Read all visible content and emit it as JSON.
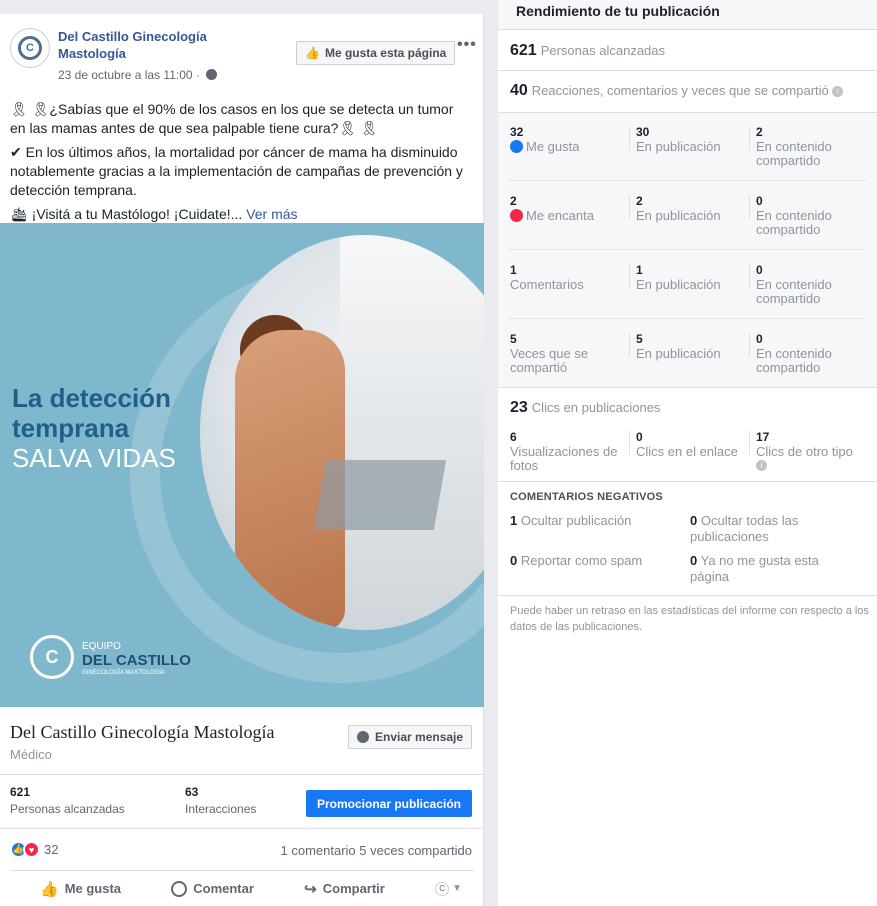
{
  "post": {
    "page_name": "Del Castillo Ginecología Mastología",
    "date": "23 de octubre a las 11:00 ·",
    "like_page_label": "Me gusta esta página",
    "more_label": "•••",
    "text_p1": "🎗 🎗¿Sabías que el 90% de los casos en los que se detecta un tumor en las mamas antes de que sea palpable tiene cura?🎗 🎗",
    "text_p2": "✔ En los últimos años, la mortalidad por cáncer de mama ha disminuido notablemente gracias a la implementación de campañas de prevención y detección temprana.",
    "text_p3": "🛳 ¡Visitá a tu Mastólogo! ¡Cuidate!...",
    "see_more": "Ver más",
    "hero": {
      "headline_1": "La detección",
      "headline_2": "temprana",
      "headline_3": "SALVA VIDAS",
      "logo_l1": "EQUIPO",
      "logo_l2": "DEL CASTILLO",
      "logo_l3": "GINECOLOGÍA  MASTOLOGÍA",
      "logo_mark": "C"
    },
    "card": {
      "name": "Del Castillo Ginecología Mastología",
      "category": "Médico",
      "message_label": "Enviar mensaje"
    },
    "stats": [
      {
        "num": "621",
        "label": "Personas alcanzadas"
      },
      {
        "num": "63",
        "label": "Interacciones"
      }
    ],
    "promote_label": "Promocionar publicación",
    "reactions_count": "32",
    "reactions_right": "1 comentario  5 veces compartido",
    "actions": {
      "like": "Me gusta",
      "comment": "Comentar",
      "share": "Compartir"
    }
  },
  "panel": {
    "title": "Rendimiento de tu publicación",
    "reach_num": "621",
    "reach_label": "Personas alcanzadas",
    "eng_num": "40",
    "eng_label": "Reacciones, comentarios y veces que se compartió",
    "rows": [
      {
        "n1": "32",
        "l1": "Me gusta",
        "n2": "30",
        "l2": "En publicación",
        "n3": "2",
        "l3": "En contenido compartido"
      },
      {
        "n1": "2",
        "l1": "Me encanta",
        "n2": "2",
        "l2": "En publicación",
        "n3": "0",
        "l3": "En contenido compartido"
      },
      {
        "n1": "1",
        "l1": "Comentarios",
        "n2": "1",
        "l2": "En publicación",
        "n3": "0",
        "l3": "En contenido compartido"
      },
      {
        "n1": "5",
        "l1": "Veces que se compartió",
        "n2": "5",
        "l2": "En publicación",
        "n3": "0",
        "l3": "En contenido compartido"
      }
    ],
    "clicks_num": "23",
    "clicks_label": "Clics en publicaciones",
    "clicks": [
      {
        "n": "6",
        "l": "Visualizaciones de fotos"
      },
      {
        "n": "0",
        "l": "Clics en el enlace"
      },
      {
        "n": "17",
        "l": "Clics de otro tipo"
      }
    ],
    "neg_title": "COMENTARIOS NEGATIVOS",
    "neg": [
      {
        "n": "1",
        "l": "Ocultar publicación"
      },
      {
        "n": "0",
        "l": "Ocultar todas las publicaciones"
      },
      {
        "n": "0",
        "l": "Reportar como spam"
      },
      {
        "n": "0",
        "l": "Ya no me gusta esta página"
      }
    ],
    "note": "Puede haber un retraso en las estadísticas del informe con respecto a los datos de las publicaciones."
  },
  "colors": {
    "accent": "#1877f2",
    "link": "#365899",
    "hero_bg": "#7fb8cc",
    "love": "#f0284a"
  },
  "icons": [
    "globe-icon",
    "thumbs-up-icon",
    "more-icon",
    "messenger-icon",
    "like-reaction-icon",
    "love-reaction-icon",
    "comment-icon",
    "share-icon",
    "info-icon",
    "chevron-down-icon"
  ]
}
